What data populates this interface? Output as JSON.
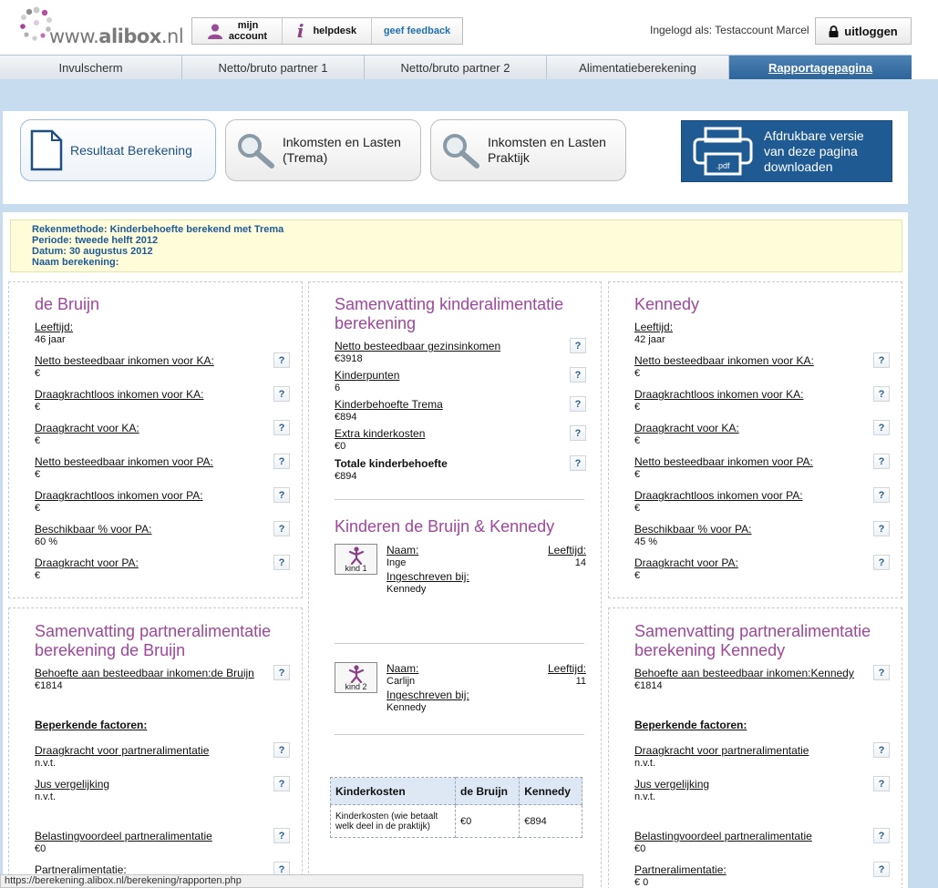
{
  "header": {
    "logo_text_prefix": "www.",
    "logo_text_brand": "alibox",
    "logo_text_suffix": ".nl",
    "buttons": [
      {
        "label_line1": "mijn",
        "label_line2": "account",
        "icon": "user-icon"
      },
      {
        "label": "helpdesk",
        "icon": "info-icon"
      },
      {
        "label": "geef feedback"
      }
    ],
    "login_text": "Ingelogd als: Testaccount Marcel",
    "logout_label": "uitloggen"
  },
  "nav": {
    "tabs": [
      {
        "label": "Invulscherm"
      },
      {
        "label": "Netto/bruto partner 1"
      },
      {
        "label": "Netto/bruto partner 2"
      },
      {
        "label": "Alimentatieberekening"
      },
      {
        "label": "Rapportagepagina",
        "active": true
      }
    ]
  },
  "actions": {
    "result_label": "Resultaat Berekening",
    "trema_label_1": "Inkomsten en Lasten",
    "trema_label_2": "(Trema)",
    "praktijk_label_1": "Inkomsten en Lasten",
    "praktijk_label_2": "Praktijk",
    "pdf_label_1": "Afdrukbare versie",
    "pdf_label_2": "van deze pagina",
    "pdf_label_3": "downloaden",
    "pdf_icon_text": ".pdf"
  },
  "info": {
    "rekenmethode": "Rekenmethode: Kinderbehoefte berekend met Trema",
    "periode": "Periode: tweede helft 2012",
    "datum": "Datum: 30 augustus 2012",
    "naam": "Naam berekening:"
  },
  "left": {
    "title": "de Bruijn",
    "fields": [
      {
        "label": "Leeftijd:",
        "value": "46 jaar",
        "help": false
      },
      {
        "label": "Netto besteedbaar inkomen voor KA:",
        "value": "€",
        "help": true
      },
      {
        "label": "Draagkrachtloos inkomen voor KA:",
        "value": "€",
        "help": true
      },
      {
        "label": "Draagkracht voor KA:",
        "value": "€",
        "help": true
      },
      {
        "label": "Netto besteedbaar inkomen voor PA:",
        "value": "€",
        "help": true
      },
      {
        "label": "Draagkrachtloos inkomen voor PA:",
        "value": "€",
        "help": true
      },
      {
        "label": "Beschikbaar % voor PA:",
        "value": "60 %",
        "help": true
      },
      {
        "label": "Draagkracht voor PA:",
        "value": "€",
        "help": true
      }
    ]
  },
  "right": {
    "title": "Kennedy",
    "fields": [
      {
        "label": "Leeftijd:",
        "value": "42 jaar",
        "help": false
      },
      {
        "label": "Netto besteedbaar inkomen voor KA:",
        "value": "€",
        "help": true
      },
      {
        "label": "Draagkrachtloos inkomen voor KA:",
        "value": "€",
        "help": true
      },
      {
        "label": "Draagkracht voor KA:",
        "value": "€",
        "help": true
      },
      {
        "label": "Netto besteedbaar inkomen voor PA:",
        "value": "€",
        "help": true
      },
      {
        "label": "Draagkrachtloos inkomen voor PA:",
        "value": "€",
        "help": true
      },
      {
        "label": "Beschikbaar % voor PA:",
        "value": "45 %",
        "help": true
      },
      {
        "label": "Draagkracht voor PA:",
        "value": "€",
        "help": true
      }
    ]
  },
  "middle": {
    "title_1": "Samenvatting kinderalimentatie",
    "title_2": "berekening",
    "fields": [
      {
        "label": "Netto besteedbaar gezinsinkomen",
        "value": "€3918"
      },
      {
        "label": "Kinderpunten",
        "value": "6"
      },
      {
        "label": "Kinderbehoefte Trema",
        "value": "€894"
      },
      {
        "label": "Extra kinderkosten",
        "value": "€0"
      },
      {
        "label": "Totale kinderbehoefte",
        "value": "€894"
      }
    ],
    "kids_title": "Kinderen de Bruijn & Kennedy",
    "kids": [
      {
        "badge": "kind 1",
        "name_label": "Naam:",
        "name": "Inge",
        "reg_label": "Ingeschreven bij:",
        "reg": "Kennedy",
        "age_label": "Leeftijd:",
        "age": "14"
      },
      {
        "badge": "kind 2",
        "name_label": "Naam:",
        "name": "Carlijn",
        "reg_label": "Ingeschreven bij:",
        "reg": "Kennedy",
        "age_label": "Leeftijd:",
        "age": "11"
      }
    ],
    "table": {
      "headers": [
        "Kinderkosten",
        "de Bruijn",
        "Kennedy"
      ],
      "row_label": "Kinderkosten (wie betaalt welk deel in de praktijk)",
      "row_bruijn": "€0",
      "row_kennedy": "€894"
    }
  },
  "left2": {
    "title_1": "Samenvatting partneralimentatie",
    "title_2": "berekening de Bruijn",
    "behoefte_label": "Behoefte aan besteedbaar inkomen:de Bruijn",
    "behoefte_value": "€1814",
    "beperkende": "Beperkende factoren:",
    "draag_label": "Draagkracht voor partneralimentatie",
    "draag_value": "n.v.t.",
    "jus_label": "Jus vergelijking",
    "jus_value": "n.v.t.",
    "belasting_label": "Belastingvoordeel partneralimentatie",
    "belasting_value": "€0",
    "pa_label": "Partneralimentatie:"
  },
  "right2": {
    "title_1": "Samenvatting partneralimentatie",
    "title_2": "berekening Kennedy",
    "behoefte_label": "Behoefte aan besteedbaar inkomen:Kennedy",
    "behoefte_value": "€1814",
    "beperkende": "Beperkende factoren:",
    "draag_label": "Draagkracht voor partneralimentatie",
    "draag_value": "n.v.t.",
    "jus_label": "Jus vergelijking",
    "jus_value": "n.v.t.",
    "belasting_label": "Belastingvoordeel partneralimentatie",
    "belasting_value": "€0",
    "pa_label": "Partneralimentatie:",
    "pa_value": "€ 0"
  },
  "help_symbol": "?",
  "status_url": "https://berekening.alibox.nl/berekening/rapporten.php"
}
